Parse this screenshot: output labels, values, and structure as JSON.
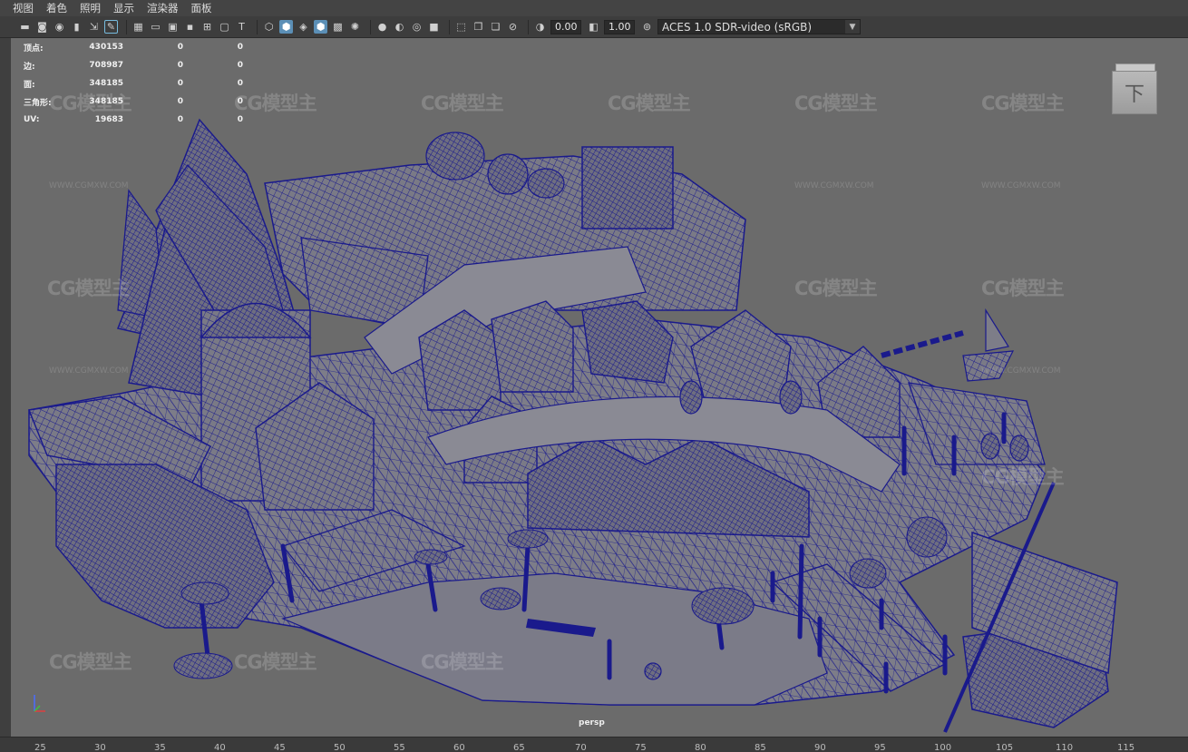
{
  "menubar": {
    "items": [
      "视图",
      "着色",
      "照明",
      "显示",
      "渲染器",
      "面板"
    ]
  },
  "toolbar": {
    "exposure_value": "0.00",
    "gamma_value": "1.00",
    "color_space": "ACES 1.0 SDR-video (sRGB)"
  },
  "hud": {
    "rows": [
      {
        "label": "顶点:",
        "values": [
          "430153",
          "0",
          "0"
        ]
      },
      {
        "label": "边:",
        "values": [
          "708987",
          "0",
          "0"
        ]
      },
      {
        "label": "面:",
        "values": [
          "348185",
          "0",
          "0"
        ]
      },
      {
        "label": "三角形:",
        "values": [
          "348185",
          "0",
          "0"
        ]
      },
      {
        "label": "UV:",
        "values": [
          "19683",
          "0",
          "0"
        ]
      }
    ]
  },
  "viewcube": {
    "face_label": "下"
  },
  "watermark": {
    "text": "CG模型主",
    "url": "WWW.CGMXW.COM"
  },
  "camera_label": "persp",
  "timeline": {
    "ticks": [
      "25",
      "30",
      "35",
      "40",
      "45",
      "50",
      "55",
      "60",
      "65",
      "70",
      "75",
      "80",
      "85",
      "90",
      "95",
      "100",
      "105",
      "110",
      "115"
    ]
  },
  "colors": {
    "wire": "#1a1a8c",
    "mesh_fill": "#7a7a86",
    "viewport_bg": "#6b6b6b",
    "accent": "#5b8fb6"
  }
}
